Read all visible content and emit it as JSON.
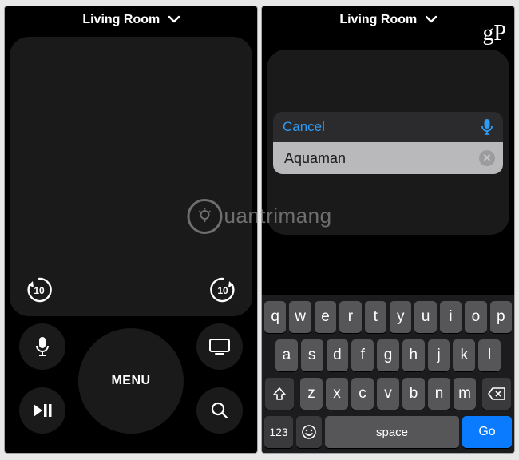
{
  "device_name": "Living Room",
  "left": {
    "rewind_seconds": "10",
    "forward_seconds": "10",
    "menu_label": "MENU"
  },
  "right": {
    "gp_mark": "gP",
    "cancel_label": "Cancel",
    "search_value": "Aquaman"
  },
  "keyboard": {
    "row1": [
      "q",
      "w",
      "e",
      "r",
      "t",
      "y",
      "u",
      "i",
      "o",
      "p"
    ],
    "row2": [
      "a",
      "s",
      "d",
      "f",
      "g",
      "h",
      "j",
      "k",
      "l"
    ],
    "row3": [
      "z",
      "x",
      "c",
      "v",
      "b",
      "n",
      "m"
    ],
    "numbers_label": "123",
    "space_label": "space",
    "go_label": "Go",
    "go_color": "#0a7aff"
  },
  "watermark_text": "uantrimang"
}
